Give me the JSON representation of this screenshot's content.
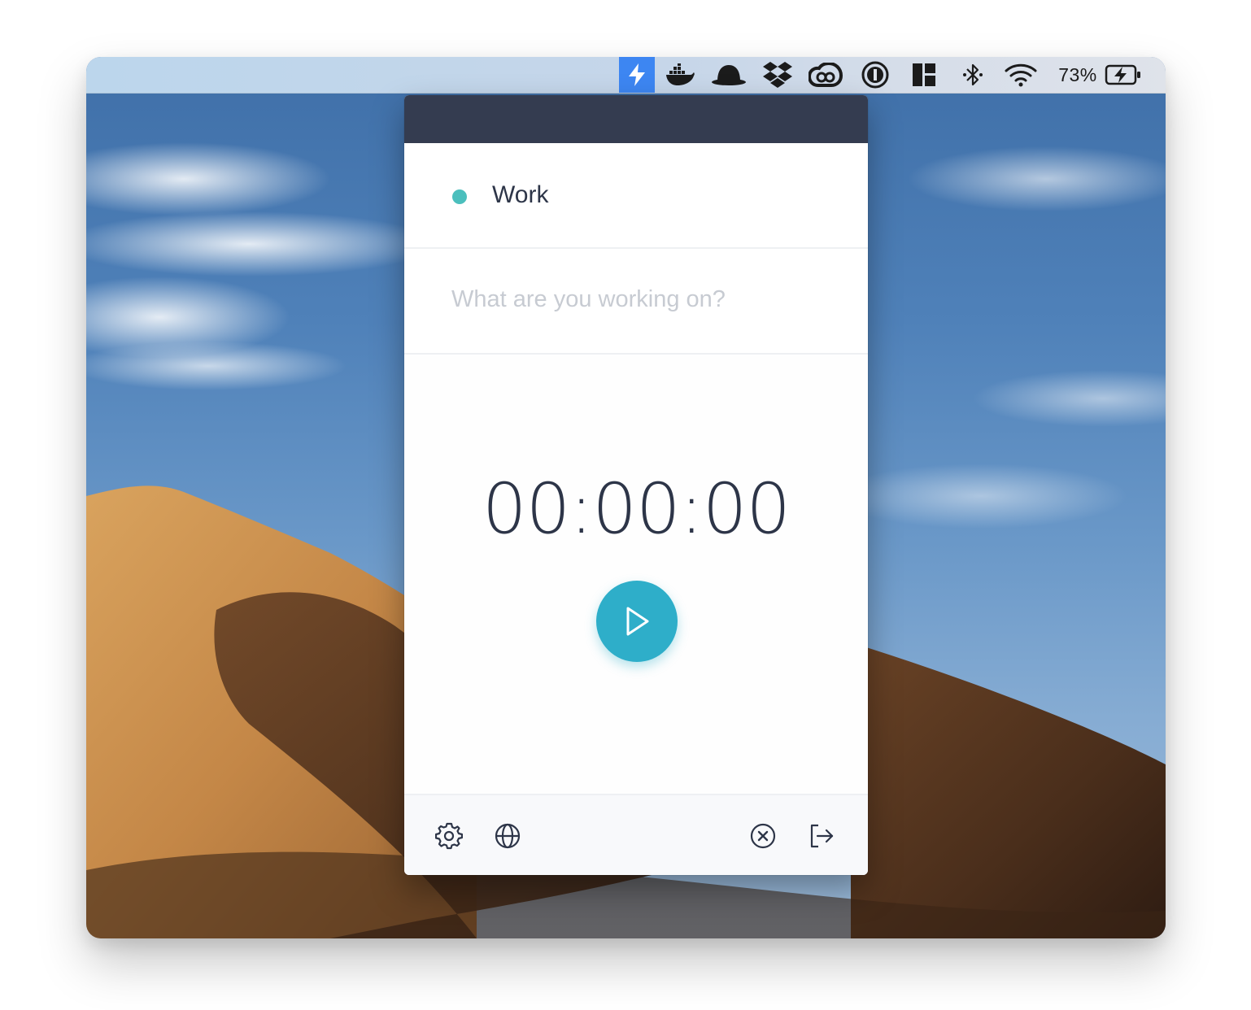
{
  "menubar": {
    "icons": [
      "lightning-app-icon",
      "docker-icon",
      "bowler-hat-icon",
      "dropbox-icon",
      "creative-cloud-icon",
      "1password-icon",
      "magnet-icon",
      "bluetooth-icon",
      "wifi-icon",
      "battery-charging-icon"
    ],
    "active_icon": "lightning-app-icon",
    "battery_percent": "73%"
  },
  "popover": {
    "project": {
      "name": "Work",
      "color": "#4bbfbd"
    },
    "task": {
      "value": "",
      "placeholder": "What are you working on?"
    },
    "timer": {
      "display": "00:00:00"
    },
    "play_button": {
      "icon": "play-icon",
      "color": "#2eaec9"
    },
    "footer": {
      "left_icons": [
        "gear-icon",
        "globe-icon"
      ],
      "right_icons": [
        "close-circle-icon",
        "logout-icon"
      ]
    }
  },
  "colors": {
    "header": "#343c50",
    "text": "#2d3548",
    "menubar_active": "#3d86f2"
  }
}
